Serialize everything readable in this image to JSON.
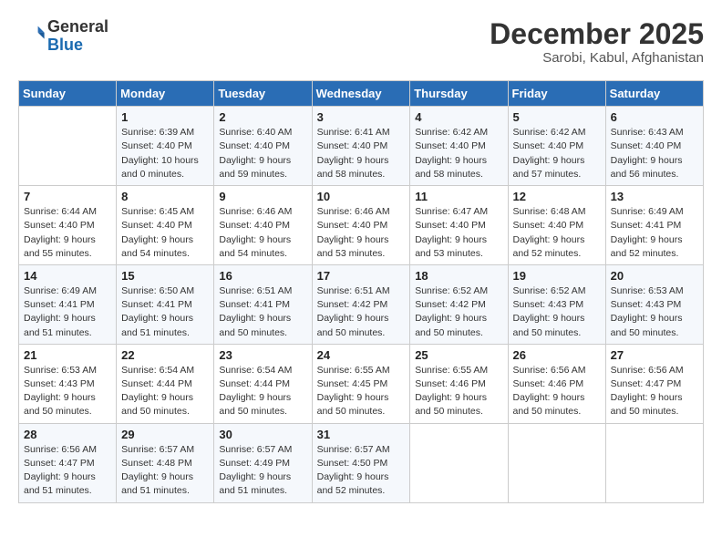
{
  "logo": {
    "line1": "General",
    "line2": "Blue"
  },
  "title": "December 2025",
  "subtitle": "Sarobi, Kabul, Afghanistan",
  "days_of_week": [
    "Sunday",
    "Monday",
    "Tuesday",
    "Wednesday",
    "Thursday",
    "Friday",
    "Saturday"
  ],
  "weeks": [
    [
      {
        "num": "",
        "info": ""
      },
      {
        "num": "1",
        "info": "Sunrise: 6:39 AM\nSunset: 4:40 PM\nDaylight: 10 hours\nand 0 minutes."
      },
      {
        "num": "2",
        "info": "Sunrise: 6:40 AM\nSunset: 4:40 PM\nDaylight: 9 hours\nand 59 minutes."
      },
      {
        "num": "3",
        "info": "Sunrise: 6:41 AM\nSunset: 4:40 PM\nDaylight: 9 hours\nand 58 minutes."
      },
      {
        "num": "4",
        "info": "Sunrise: 6:42 AM\nSunset: 4:40 PM\nDaylight: 9 hours\nand 58 minutes."
      },
      {
        "num": "5",
        "info": "Sunrise: 6:42 AM\nSunset: 4:40 PM\nDaylight: 9 hours\nand 57 minutes."
      },
      {
        "num": "6",
        "info": "Sunrise: 6:43 AM\nSunset: 4:40 PM\nDaylight: 9 hours\nand 56 minutes."
      }
    ],
    [
      {
        "num": "7",
        "info": "Sunrise: 6:44 AM\nSunset: 4:40 PM\nDaylight: 9 hours\nand 55 minutes."
      },
      {
        "num": "8",
        "info": "Sunrise: 6:45 AM\nSunset: 4:40 PM\nDaylight: 9 hours\nand 54 minutes."
      },
      {
        "num": "9",
        "info": "Sunrise: 6:46 AM\nSunset: 4:40 PM\nDaylight: 9 hours\nand 54 minutes."
      },
      {
        "num": "10",
        "info": "Sunrise: 6:46 AM\nSunset: 4:40 PM\nDaylight: 9 hours\nand 53 minutes."
      },
      {
        "num": "11",
        "info": "Sunrise: 6:47 AM\nSunset: 4:40 PM\nDaylight: 9 hours\nand 53 minutes."
      },
      {
        "num": "12",
        "info": "Sunrise: 6:48 AM\nSunset: 4:40 PM\nDaylight: 9 hours\nand 52 minutes."
      },
      {
        "num": "13",
        "info": "Sunrise: 6:49 AM\nSunset: 4:41 PM\nDaylight: 9 hours\nand 52 minutes."
      }
    ],
    [
      {
        "num": "14",
        "info": "Sunrise: 6:49 AM\nSunset: 4:41 PM\nDaylight: 9 hours\nand 51 minutes."
      },
      {
        "num": "15",
        "info": "Sunrise: 6:50 AM\nSunset: 4:41 PM\nDaylight: 9 hours\nand 51 minutes."
      },
      {
        "num": "16",
        "info": "Sunrise: 6:51 AM\nSunset: 4:41 PM\nDaylight: 9 hours\nand 50 minutes."
      },
      {
        "num": "17",
        "info": "Sunrise: 6:51 AM\nSunset: 4:42 PM\nDaylight: 9 hours\nand 50 minutes."
      },
      {
        "num": "18",
        "info": "Sunrise: 6:52 AM\nSunset: 4:42 PM\nDaylight: 9 hours\nand 50 minutes."
      },
      {
        "num": "19",
        "info": "Sunrise: 6:52 AM\nSunset: 4:43 PM\nDaylight: 9 hours\nand 50 minutes."
      },
      {
        "num": "20",
        "info": "Sunrise: 6:53 AM\nSunset: 4:43 PM\nDaylight: 9 hours\nand 50 minutes."
      }
    ],
    [
      {
        "num": "21",
        "info": "Sunrise: 6:53 AM\nSunset: 4:43 PM\nDaylight: 9 hours\nand 50 minutes."
      },
      {
        "num": "22",
        "info": "Sunrise: 6:54 AM\nSunset: 4:44 PM\nDaylight: 9 hours\nand 50 minutes."
      },
      {
        "num": "23",
        "info": "Sunrise: 6:54 AM\nSunset: 4:44 PM\nDaylight: 9 hours\nand 50 minutes."
      },
      {
        "num": "24",
        "info": "Sunrise: 6:55 AM\nSunset: 4:45 PM\nDaylight: 9 hours\nand 50 minutes."
      },
      {
        "num": "25",
        "info": "Sunrise: 6:55 AM\nSunset: 4:46 PM\nDaylight: 9 hours\nand 50 minutes."
      },
      {
        "num": "26",
        "info": "Sunrise: 6:56 AM\nSunset: 4:46 PM\nDaylight: 9 hours\nand 50 minutes."
      },
      {
        "num": "27",
        "info": "Sunrise: 6:56 AM\nSunset: 4:47 PM\nDaylight: 9 hours\nand 50 minutes."
      }
    ],
    [
      {
        "num": "28",
        "info": "Sunrise: 6:56 AM\nSunset: 4:47 PM\nDaylight: 9 hours\nand 51 minutes."
      },
      {
        "num": "29",
        "info": "Sunrise: 6:57 AM\nSunset: 4:48 PM\nDaylight: 9 hours\nand 51 minutes."
      },
      {
        "num": "30",
        "info": "Sunrise: 6:57 AM\nSunset: 4:49 PM\nDaylight: 9 hours\nand 51 minutes."
      },
      {
        "num": "31",
        "info": "Sunrise: 6:57 AM\nSunset: 4:50 PM\nDaylight: 9 hours\nand 52 minutes."
      },
      {
        "num": "",
        "info": ""
      },
      {
        "num": "",
        "info": ""
      },
      {
        "num": "",
        "info": ""
      }
    ]
  ]
}
